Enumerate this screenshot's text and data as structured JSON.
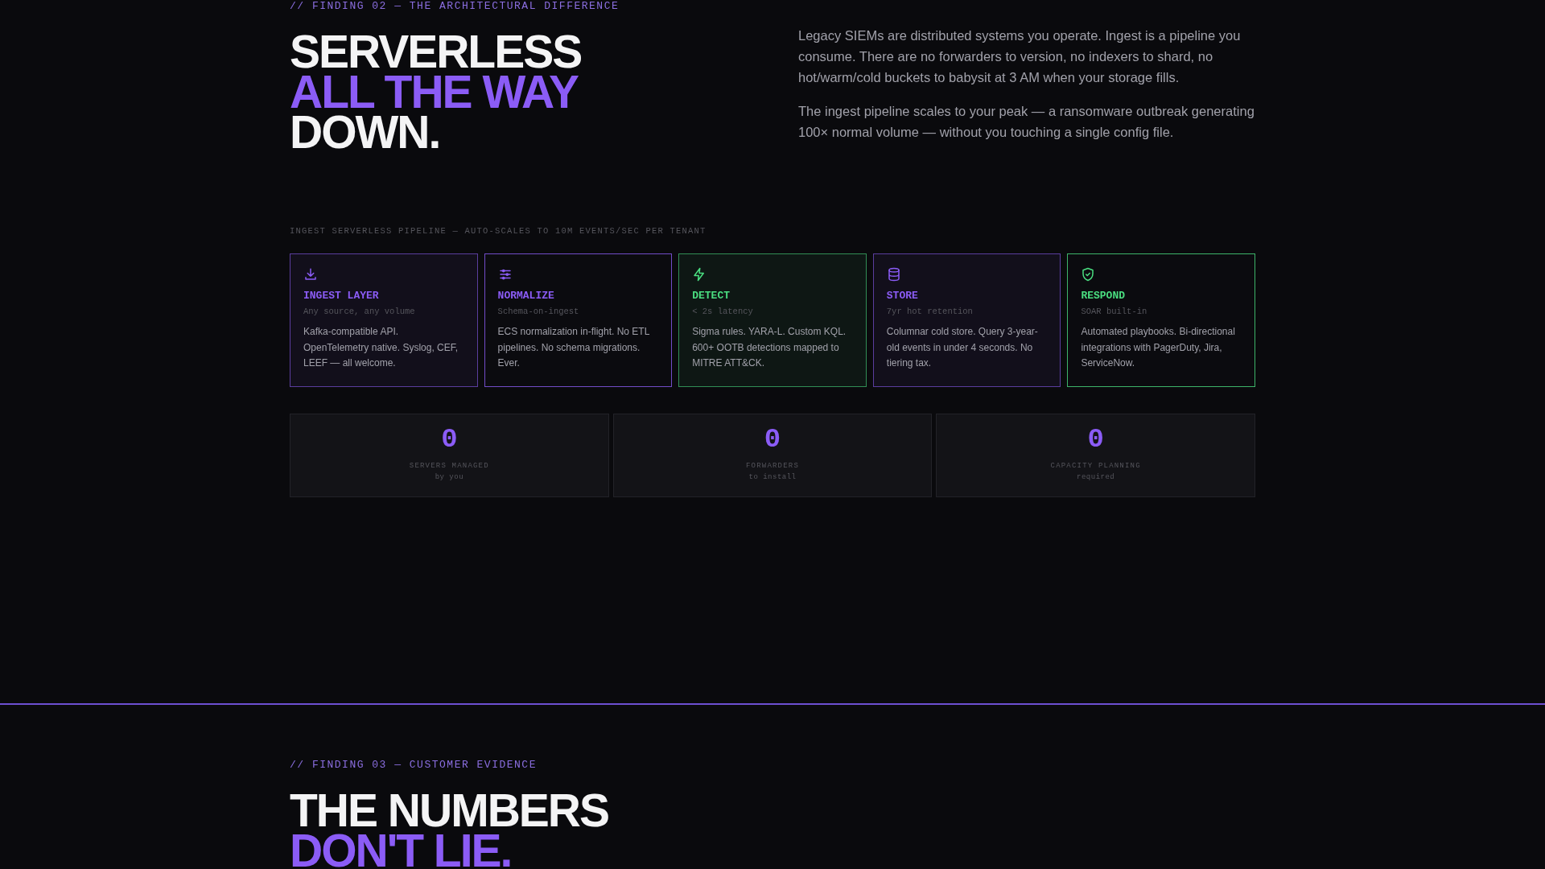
{
  "finding_02": {
    "eyebrow": "// FINDING 02 — THE ARCHITECTURAL DIFFERENCE",
    "headline": [
      {
        "text": "SERVERLESS",
        "highlighted": false
      },
      {
        "text": "ALL THE WAY",
        "highlighted": true
      },
      {
        "text": "DOWN.",
        "highlighted": false
      }
    ],
    "paragraphs": [
      "Legacy SIEMs are distributed systems you operate. Ingest is a pipeline you consume. There are no forwarders to version, no indexers to shard, no hot/warm/cold buckets to babysit at 3 AM when your storage fills.",
      "The ingest pipeline scales to your peak — a ransomware outbreak generating 100× normal volume — without you touching a single config file."
    ],
    "pipeline_caption": "INGEST SERVERLESS PIPELINE — AUTO-SCALES TO 10M EVENTS/SEC PER TENANT",
    "pipeline": [
      {
        "title": "INGEST LAYER",
        "subtitle": "Any source, any volume",
        "text": "Kafka-compatible API. OpenTelemetry native. Syslog, CEF, LEEF — all welcome.",
        "color": "#8b5cf6",
        "highlighted": true
      },
      {
        "title": "NORMALIZE",
        "subtitle": "Schema-on-ingest",
        "text": "ECS normalization in-flight. No ETL pipelines. No schema migrations. Ever.",
        "color": "#8b5cf6",
        "highlighted": false
      },
      {
        "title": "DETECT",
        "subtitle": "< 2s latency",
        "text": "Sigma rules. YARA-L. Custom KQL. 600+ OOTB detections mapped to MITRE ATT&CK.",
        "color": "#4ade80",
        "highlighted": true
      },
      {
        "title": "STORE",
        "subtitle": "7yr hot retention",
        "text": "Columnar cold store. Query 3-year-old events in under 4 seconds. No tiering tax.",
        "color": "#8b5cf6",
        "highlighted": true
      },
      {
        "title": "RESPOND",
        "subtitle": "SOAR built-in",
        "text": "Automated playbooks. Bi-directional integrations with PagerDuty, Jira, ServiceNow.",
        "color": "#4ade80",
        "highlighted": false
      }
    ],
    "stats": [
      {
        "value": "0",
        "label": "SERVERS MANAGED",
        "note": "by you"
      },
      {
        "value": "0",
        "label": "FORWARDERS",
        "note": "to install"
      },
      {
        "value": "0",
        "label": "CAPACITY PLANNING",
        "note": "required"
      }
    ]
  },
  "finding_03": {
    "eyebrow": "// FINDING 03 — CUSTOMER EVIDENCE",
    "headline": [
      {
        "text": "THE NUMBERS",
        "highlighted": false
      },
      {
        "text": "DON'T LIE.",
        "highlighted": true
      }
    ]
  }
}
